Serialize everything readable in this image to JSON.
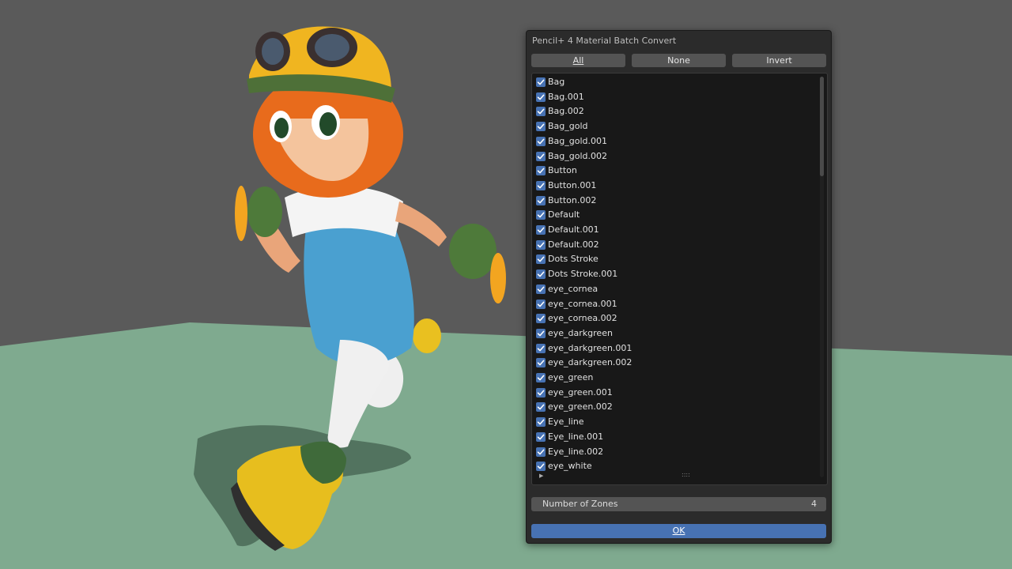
{
  "dialog": {
    "title": "Pencil+ 4 Material Batch Convert",
    "buttons": {
      "all_label": "All",
      "none_label": "None",
      "invert_label": "Invert"
    },
    "materials": [
      {
        "name": "Bag",
        "checked": true
      },
      {
        "name": "Bag.001",
        "checked": true
      },
      {
        "name": "Bag.002",
        "checked": true
      },
      {
        "name": "Bag_gold",
        "checked": true
      },
      {
        "name": "Bag_gold.001",
        "checked": true
      },
      {
        "name": "Bag_gold.002",
        "checked": true
      },
      {
        "name": "Button",
        "checked": true
      },
      {
        "name": "Button.001",
        "checked": true
      },
      {
        "name": "Button.002",
        "checked": true
      },
      {
        "name": "Default",
        "checked": true
      },
      {
        "name": "Default.001",
        "checked": true
      },
      {
        "name": "Default.002",
        "checked": true
      },
      {
        "name": "Dots Stroke",
        "checked": true
      },
      {
        "name": "Dots Stroke.001",
        "checked": true
      },
      {
        "name": "eye_cornea",
        "checked": true
      },
      {
        "name": "eye_cornea.001",
        "checked": true
      },
      {
        "name": "eye_cornea.002",
        "checked": true
      },
      {
        "name": "eye_darkgreen",
        "checked": true
      },
      {
        "name": "eye_darkgreen.001",
        "checked": true
      },
      {
        "name": "eye_darkgreen.002",
        "checked": true
      },
      {
        "name": "eye_green",
        "checked": true
      },
      {
        "name": "eye_green.001",
        "checked": true
      },
      {
        "name": "eye_green.002",
        "checked": true
      },
      {
        "name": "Eye_line",
        "checked": true
      },
      {
        "name": "Eye_line.001",
        "checked": true
      },
      {
        "name": "Eye_line.002",
        "checked": true
      },
      {
        "name": "eye_white",
        "checked": true
      }
    ],
    "zones": {
      "label": "Number of Zones",
      "value": "4"
    },
    "ok_label": "OK",
    "accent_color": "#4772b3"
  }
}
